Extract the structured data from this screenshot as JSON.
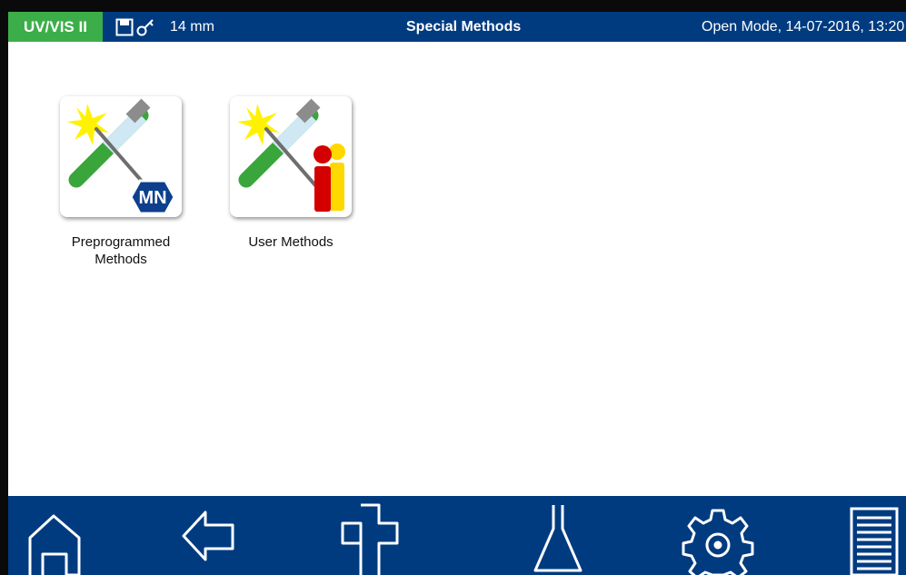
{
  "statusbar": {
    "brand": "UV/VIS II",
    "cuvette": "14 mm",
    "title": "Special Methods",
    "mode_datetime": "Open Mode, 14-07-2016, 13:20"
  },
  "tiles": [
    {
      "label": "Preprogrammed\nMethods",
      "badge": "MN"
    },
    {
      "label": "User Methods"
    }
  ],
  "toolbar": {
    "icons": [
      "home-icon",
      "back-arrow-icon",
      "plus-icon",
      "flask-icon",
      "gear-icon",
      "menu-list-icon"
    ]
  },
  "colors": {
    "header_blue": "#003b80",
    "brand_green": "#3cae49",
    "tube_green": "#3aa53a",
    "star_yellow": "#fff200",
    "user_red": "#d40000",
    "user_yellow": "#ffd800"
  }
}
